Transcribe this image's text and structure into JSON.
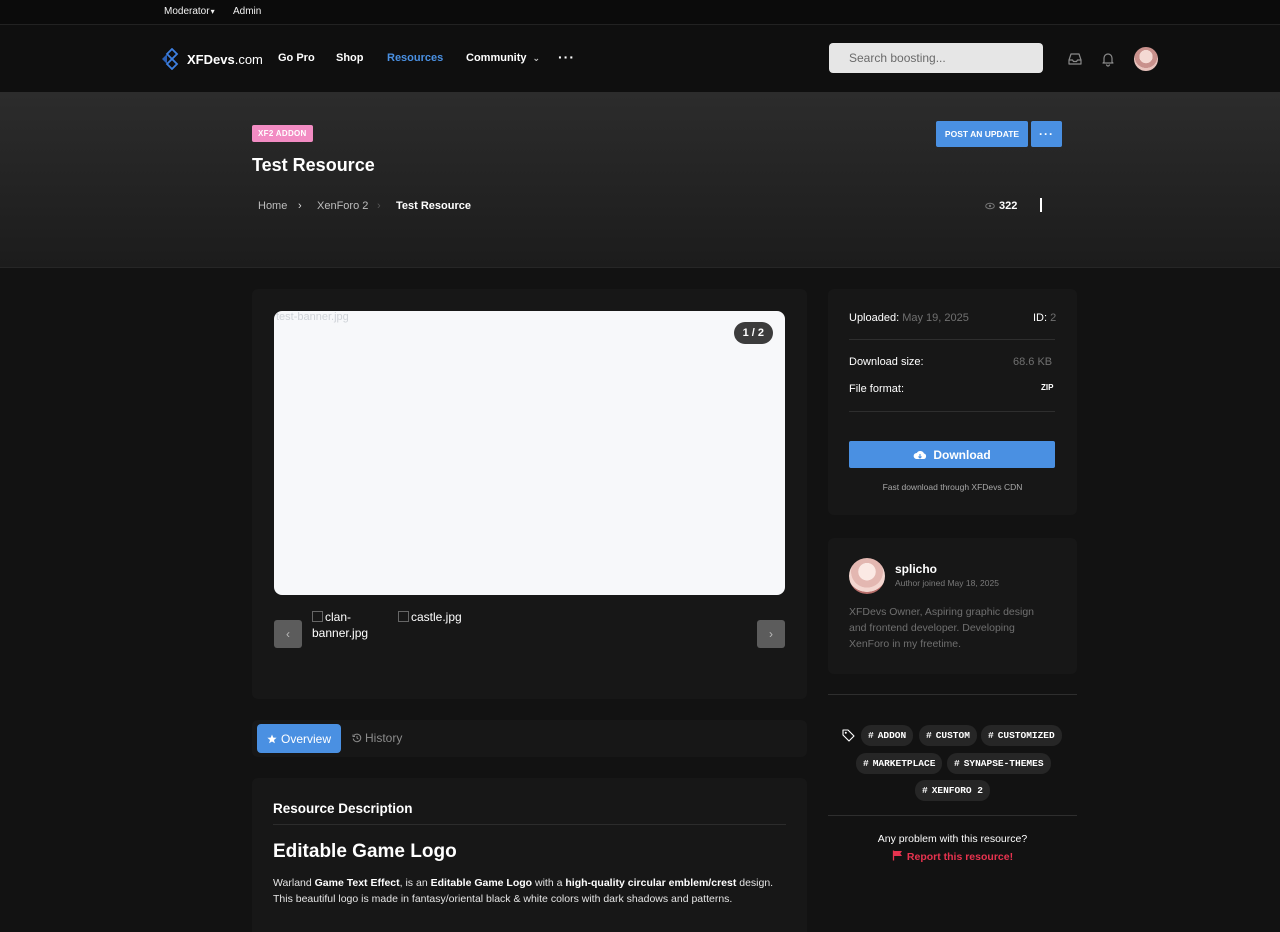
{
  "staffbar": {
    "moderator": "Moderator",
    "admin": "Admin"
  },
  "header": {
    "logo_text": "XFDevs",
    "logo_suffix": ".com",
    "nav": {
      "gopro": "Go Pro",
      "shop": "Shop",
      "resources": "Resources",
      "community": "Community",
      "more": "···"
    },
    "search_placeholder": "Search boosting..."
  },
  "banner": {
    "badge": "XF2 ADDON",
    "title": "Test Resource",
    "breadcrumbs": [
      "Home",
      "XenForo 2",
      "Test Resource"
    ],
    "post_update": "POST AN UPDATE",
    "more": "···",
    "views": "322"
  },
  "gallery": {
    "main_alt": "test-banner.jpg",
    "counter": "1 / 2",
    "thumbs": [
      "clan-banner.jpg",
      "castle.jpg"
    ]
  },
  "tabs": {
    "overview": "Overview",
    "history": "History"
  },
  "description": {
    "heading": "Resource Description",
    "title": "Editable Game Logo",
    "p_1": "Warland ",
    "b_1": "Game Text Effect",
    "p_2": ", is an ",
    "b_2": "Editable Game Logo",
    "p_3": " with a ",
    "b_3": "high-quality circular emblem/crest",
    "p_4": " design. This beautiful logo is made in fantasy/oriental black & white colors with dark shadows and patterns."
  },
  "info": {
    "uploaded_label": "Uploaded:",
    "uploaded_value": "May 19, 2025",
    "id_label": "ID:",
    "id_value": "2",
    "size_label": "Download size:",
    "size_value": "68.6 KB",
    "format_label": "File format:",
    "format_value": "ZIP",
    "download": "Download",
    "cdn_note": "Fast download through XFDevs CDN"
  },
  "author": {
    "name": "splicho",
    "joined": "Author joined May 18, 2025",
    "bio": "XFDevs Owner, Aspiring graphic design and frontend developer. Developing XenForo in my freetime."
  },
  "tags": [
    "ADDON",
    "CUSTOM",
    "CUSTOMIZED",
    "MARKETPLACE",
    "SYNAPSE-THEMES",
    "XENFORO 2"
  ],
  "report": {
    "question": "Any problem with this resource?",
    "link": "Report this resource!"
  },
  "colors": {
    "accent": "#4a90e2",
    "badge": "#f28cc3",
    "danger": "#e8334f"
  }
}
